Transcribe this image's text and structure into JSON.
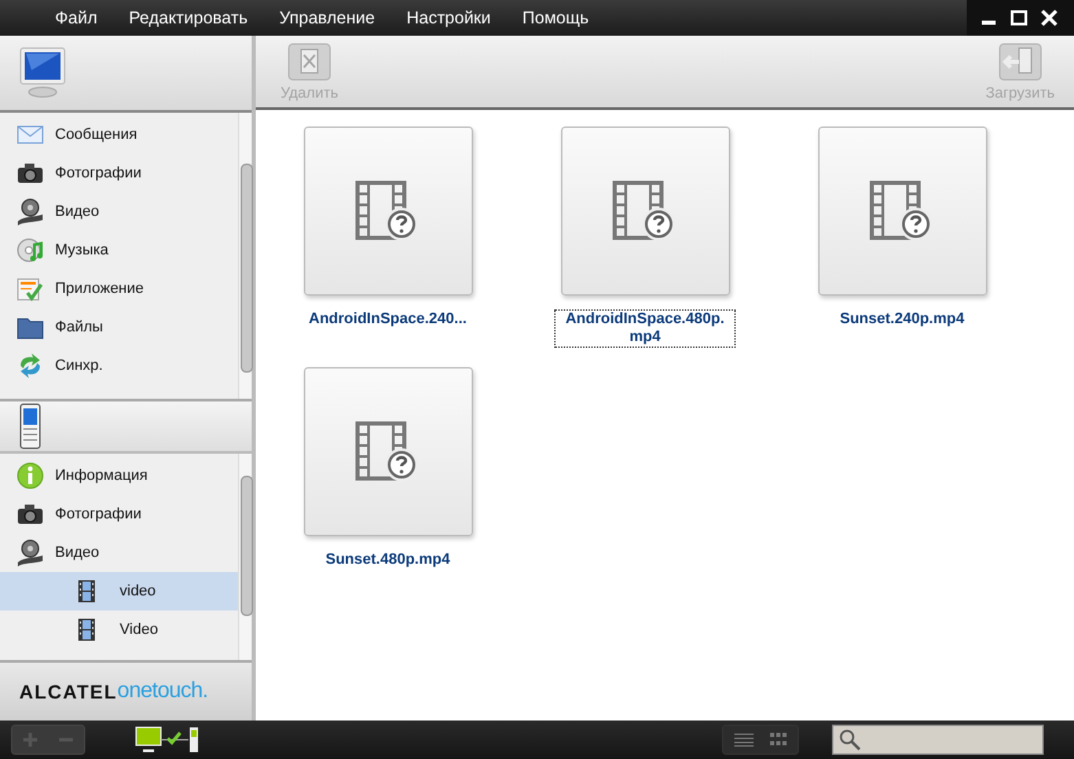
{
  "menu": [
    "Файл",
    "Редактировать",
    "Управление",
    "Настройки",
    "Помощь"
  ],
  "toolbar": [
    {
      "label": "Удалить",
      "kind": "delete",
      "disabled": true
    },
    {
      "label": "Загрузить",
      "kind": "upload",
      "disabled": true
    }
  ],
  "pc_items": [
    {
      "label": "Сообщения",
      "kind": "mail"
    },
    {
      "label": "Фотографии",
      "kind": "camera"
    },
    {
      "label": "Видео",
      "kind": "reel"
    },
    {
      "label": "Музыка",
      "kind": "music"
    },
    {
      "label": "Приложение",
      "kind": "app"
    },
    {
      "label": "Файлы",
      "kind": "folder"
    },
    {
      "label": "Синхр.",
      "kind": "sync"
    }
  ],
  "device_items": [
    {
      "label": "Информация",
      "kind": "info",
      "selected": false
    },
    {
      "label": "Фотографии",
      "kind": "camera",
      "selected": false
    },
    {
      "label": "Видео",
      "kind": "reel",
      "selected": false,
      "children": [
        {
          "label": "video",
          "kind": "film",
          "selected": true
        },
        {
          "label": "Video",
          "kind": "film",
          "selected": false
        }
      ]
    }
  ],
  "logo": {
    "brand": "ALCATEL",
    "product": "onetouch."
  },
  "files": [
    {
      "name": "AndroidInSpace.240...",
      "selected": false
    },
    {
      "name": "AndroidInSpace.480p.mp4",
      "selected": true
    },
    {
      "name": "Sunset.240p.mp4",
      "selected": false
    },
    {
      "name": "Sunset.480p.mp4",
      "selected": false
    }
  ]
}
